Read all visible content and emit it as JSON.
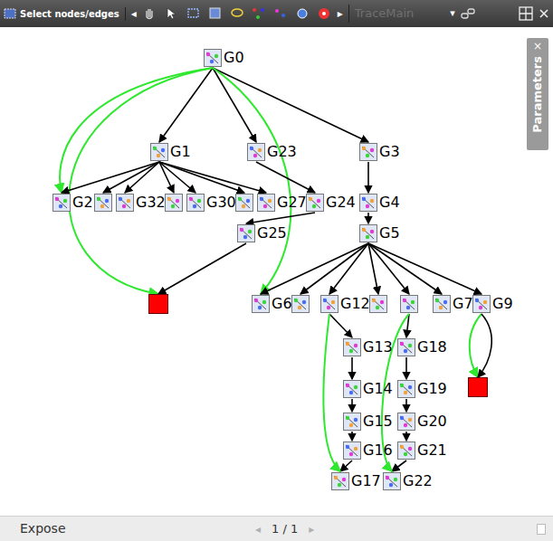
{
  "toolbar": {
    "mode": "Select nodes/edges",
    "prev": "◂",
    "next": "▸",
    "view": "TraceMain",
    "view_disabled": true,
    "dropdown": "▾"
  },
  "panel_tab": {
    "label": "Parameters",
    "close": "×"
  },
  "graph": {
    "nodes": [
      {
        "label": "G0",
        "kind": "thumb"
      },
      {
        "label": "G1",
        "kind": "thumb"
      },
      {
        "label": "G23",
        "kind": "thumb"
      },
      {
        "label": "G3",
        "kind": "thumb"
      },
      {
        "label": "G2",
        "kind": "thumb"
      },
      {
        "label": "",
        "kind": "thumb"
      },
      {
        "label": "G32",
        "kind": "thumb"
      },
      {
        "label": "",
        "kind": "thumb"
      },
      {
        "label": "G30",
        "kind": "thumb"
      },
      {
        "label": "",
        "kind": "thumb"
      },
      {
        "label": "G27",
        "kind": "thumb"
      },
      {
        "label": "G24",
        "kind": "thumb"
      },
      {
        "label": "G25",
        "kind": "thumb"
      },
      {
        "label": "",
        "kind": "box",
        "color": "#ff0000"
      },
      {
        "label": "G4",
        "kind": "thumb"
      },
      {
        "label": "G5",
        "kind": "thumb"
      },
      {
        "label": "G6",
        "kind": "thumb"
      },
      {
        "label": "",
        "kind": "thumb"
      },
      {
        "label": "G12",
        "kind": "thumb"
      },
      {
        "label": "",
        "kind": "thumb"
      },
      {
        "label": "",
        "kind": "thumb"
      },
      {
        "label": "G7",
        "kind": "thumb"
      },
      {
        "label": "G9",
        "kind": "thumb"
      },
      {
        "label": "G13",
        "kind": "thumb"
      },
      {
        "label": "G14",
        "kind": "thumb"
      },
      {
        "label": "G15",
        "kind": "thumb"
      },
      {
        "label": "G16",
        "kind": "thumb"
      },
      {
        "label": "G17",
        "kind": "thumb"
      },
      {
        "label": "G18",
        "kind": "thumb"
      },
      {
        "label": "G19",
        "kind": "thumb"
      },
      {
        "label": "G20",
        "kind": "thumb"
      },
      {
        "label": "G21",
        "kind": "thumb"
      },
      {
        "label": "G22",
        "kind": "thumb"
      },
      {
        "label": "",
        "kind": "box",
        "color": "#ff0000"
      }
    ],
    "edges": [
      {
        "from": 0,
        "to": 1,
        "color": "#000000"
      },
      {
        "from": 0,
        "to": 2,
        "color": "#000000"
      },
      {
        "from": 0,
        "to": 3,
        "color": "#000000"
      },
      {
        "from": 0,
        "to": 4,
        "color": "#2ee82e"
      },
      {
        "from": 0,
        "to": 13,
        "color": "#2ee82e"
      },
      {
        "from": 0,
        "to": 16,
        "color": "#2ee82e"
      },
      {
        "from": 1,
        "to": 4,
        "color": "#000000"
      },
      {
        "from": 1,
        "to": 5,
        "color": "#000000"
      },
      {
        "from": 1,
        "to": 6,
        "color": "#000000"
      },
      {
        "from": 1,
        "to": 7,
        "color": "#000000"
      },
      {
        "from": 1,
        "to": 8,
        "color": "#000000"
      },
      {
        "from": 1,
        "to": 9,
        "color": "#000000"
      },
      {
        "from": 1,
        "to": 10,
        "color": "#000000"
      },
      {
        "from": 2,
        "to": 11,
        "color": "#000000"
      },
      {
        "from": 11,
        "to": 12,
        "color": "#000000"
      },
      {
        "from": 12,
        "to": 13,
        "color": "#000000"
      },
      {
        "from": 3,
        "to": 14,
        "color": "#000000"
      },
      {
        "from": 14,
        "to": 15,
        "color": "#000000"
      },
      {
        "from": 15,
        "to": 16,
        "color": "#000000"
      },
      {
        "from": 15,
        "to": 17,
        "color": "#000000"
      },
      {
        "from": 15,
        "to": 18,
        "color": "#000000"
      },
      {
        "from": 15,
        "to": 19,
        "color": "#000000"
      },
      {
        "from": 15,
        "to": 20,
        "color": "#000000"
      },
      {
        "from": 15,
        "to": 21,
        "color": "#000000"
      },
      {
        "from": 15,
        "to": 22,
        "color": "#000000"
      },
      {
        "from": 18,
        "to": 23,
        "color": "#000000"
      },
      {
        "from": 23,
        "to": 24,
        "color": "#000000"
      },
      {
        "from": 24,
        "to": 25,
        "color": "#000000"
      },
      {
        "from": 25,
        "to": 26,
        "color": "#000000"
      },
      {
        "from": 26,
        "to": 27,
        "color": "#000000"
      },
      {
        "from": 20,
        "to": 28,
        "color": "#000000"
      },
      {
        "from": 28,
        "to": 29,
        "color": "#000000"
      },
      {
        "from": 29,
        "to": 30,
        "color": "#000000"
      },
      {
        "from": 30,
        "to": 31,
        "color": "#000000"
      },
      {
        "from": 31,
        "to": 32,
        "color": "#000000"
      },
      {
        "from": 18,
        "to": 27,
        "color": "#2ee82e"
      },
      {
        "from": 20,
        "to": 32,
        "color": "#2ee82e"
      },
      {
        "from": 22,
        "to": 33,
        "color": "#2ee82e"
      },
      {
        "from": 22,
        "to": 33,
        "color": "#000000"
      }
    ]
  },
  "status_bar": {
    "label": "Expose",
    "prev": "◂",
    "page": "1 / 1",
    "next": "▸"
  }
}
